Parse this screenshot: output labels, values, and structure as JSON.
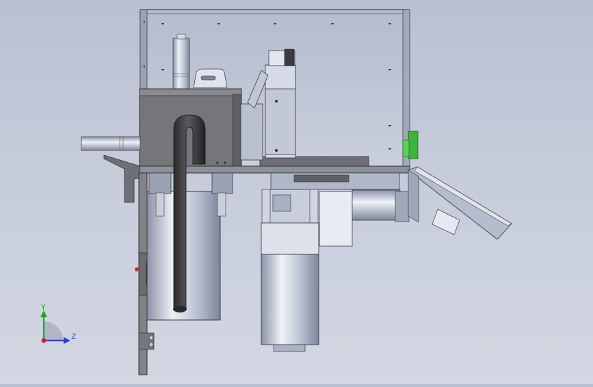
{
  "viewport": {
    "background_top": "#b9c0d2",
    "background_bottom": "#d2d7e2"
  },
  "triad": {
    "y_label": "Y",
    "z_label": "Z",
    "y_color": "#1fa81f",
    "z_color": "#2a3fd6",
    "origin_color": "#d0202a"
  },
  "model": {
    "enclosure_color": "#c3cad9",
    "frame_color": "#6c6f78",
    "housing_color": "#77787c",
    "metal_light": "#dfe3ee",
    "metal_mid": "#aab3c6",
    "accent_green": "#3db43d",
    "tube_color": "#3a3a3c"
  }
}
